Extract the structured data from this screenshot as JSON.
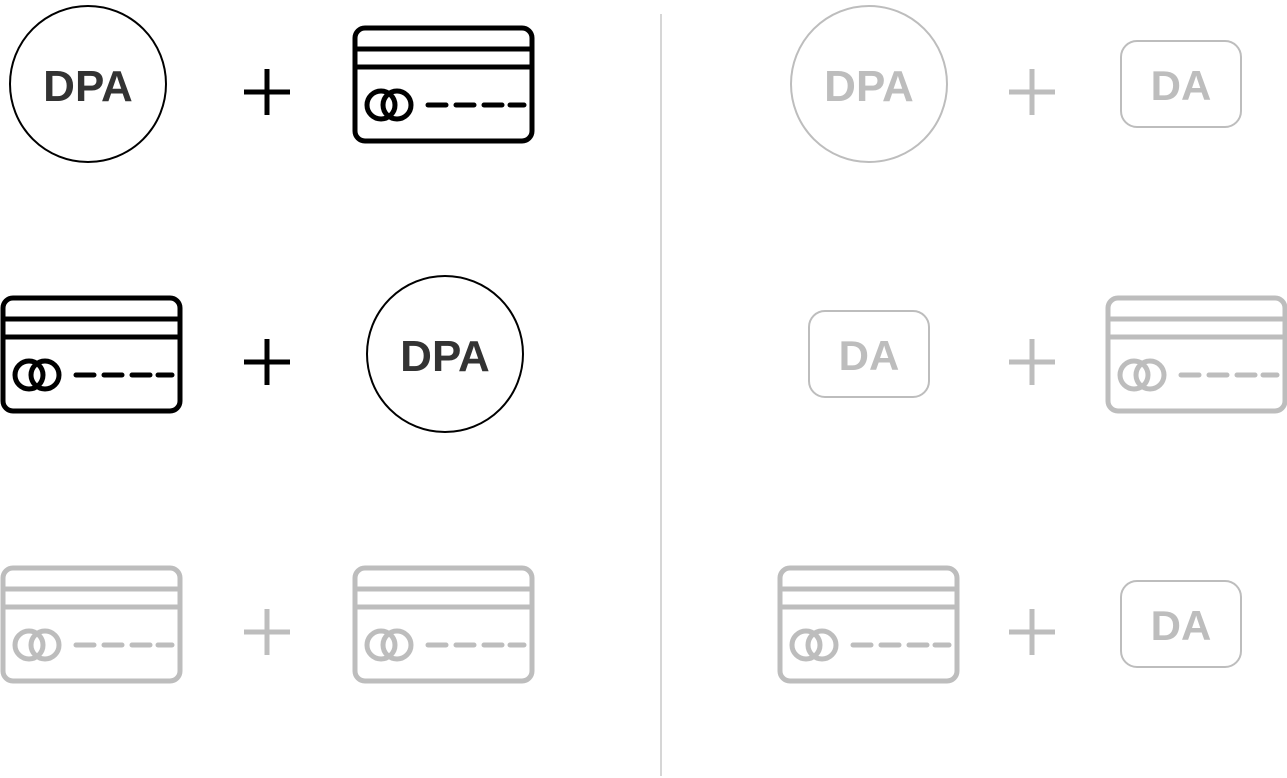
{
  "labels": {
    "dpa": "DPA",
    "da": "DA",
    "plus": "+"
  },
  "colors": {
    "active_stroke": "#000000",
    "active_text": "#333333",
    "inactive": "#bdbdbd",
    "divider": "#d6d6d6",
    "background": "#ffffff"
  },
  "rows": [
    {
      "side": "left",
      "state": "active",
      "items": [
        "dpa-badge",
        "plus",
        "card"
      ]
    },
    {
      "side": "left",
      "state": "active",
      "items": [
        "card",
        "plus",
        "dpa-badge"
      ]
    },
    {
      "side": "left",
      "state": "inactive",
      "items": [
        "card",
        "plus",
        "card"
      ]
    },
    {
      "side": "right",
      "state": "inactive",
      "items": [
        "dpa-badge",
        "plus",
        "da-badge"
      ]
    },
    {
      "side": "right",
      "state": "inactive",
      "items": [
        "da-badge",
        "plus",
        "card"
      ]
    },
    {
      "side": "right",
      "state": "inactive",
      "items": [
        "card",
        "plus",
        "da-badge"
      ]
    }
  ]
}
